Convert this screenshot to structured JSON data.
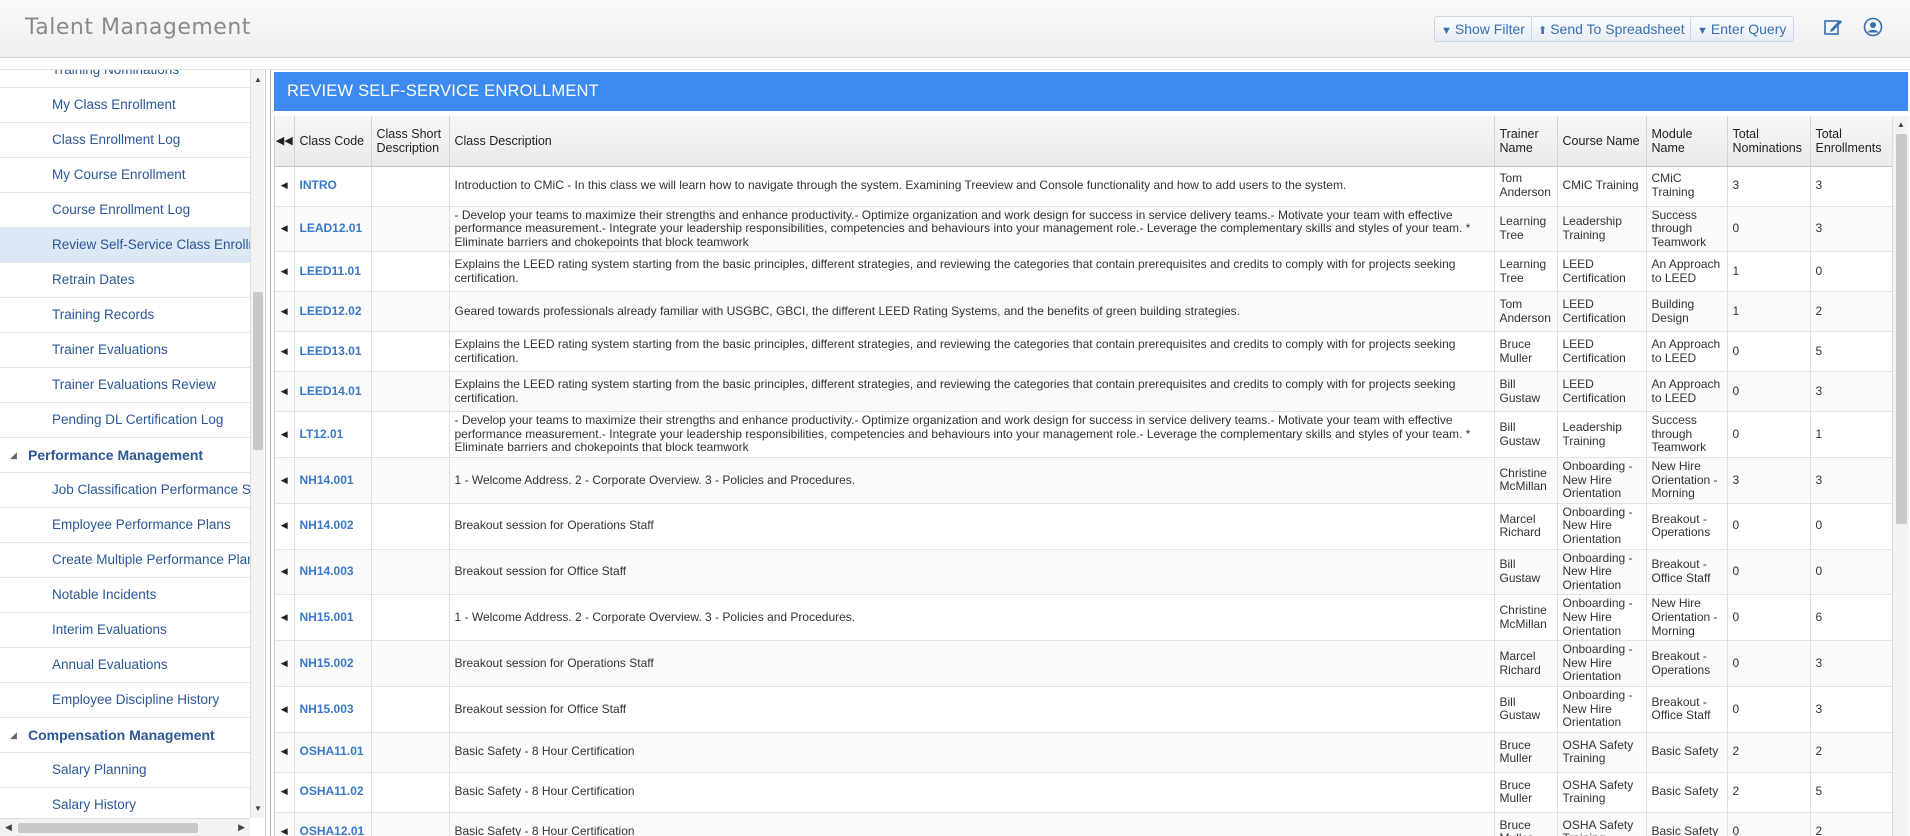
{
  "app": {
    "title": "Talent Management"
  },
  "toolbar": {
    "show_filter": "Show Filter",
    "send_to_spreadsheet": "Send To Spreadsheet",
    "enter_query": "Enter Query"
  },
  "icons": {
    "filter": "funnel-icon",
    "export": "upload-icon",
    "edit": "edit-icon",
    "user": "user-icon"
  },
  "sidebar": {
    "items": [
      "Training Nominations",
      "My Class Enrollment",
      "Class Enrollment Log",
      "My Course Enrollment",
      "Course Enrollment Log",
      "Review Self-Service Class Enrollm",
      "Retrain Dates",
      "Training Records",
      "Trainer Evaluations",
      "Trainer Evaluations Review",
      "Pending DL Certification Log"
    ],
    "selected_index": 5,
    "group_performance": "Performance Management",
    "performance_items": [
      "Job Classification Performance St",
      "Employee Performance Plans",
      "Create Multiple Performance Plans",
      "Notable Incidents",
      "Interim Evaluations",
      "Annual Evaluations",
      "Employee Discipline History"
    ],
    "group_compensation": "Compensation Management",
    "compensation_items": [
      "Salary Planning",
      "Salary History"
    ]
  },
  "page": {
    "banner": "REVIEW SELF-SERVICE ENROLLMENT"
  },
  "grid": {
    "columns": [
      "Class Code",
      "Class Short Description",
      "Class Description",
      "Trainer Name",
      "Course Name",
      "Module Name",
      "Total Nominations",
      "Total Enrollments"
    ],
    "rows": [
      [
        "INTRO",
        "",
        "Introduction to CMiC - In this class we will learn how to navigate through the system. Examining Treeview and Console functionality and how to add users to the system.",
        "Tom Anderson",
        "CMiC Training",
        "CMiC Training",
        "3",
        "3"
      ],
      [
        "LEAD12.01",
        "",
        "- Develop your teams to maximize their strengths and enhance productivity.- Optimize organization and work design for success in service delivery teams.- Motivate your team with effective performance measurement.- Integrate your leadership responsibilities, competencies and behaviours into your management role.- Leverage the complementary skills and styles of your team. * Eliminate barriers and chokepoints that block teamwork",
        "Learning Tree",
        "Leadership Training",
        "Success through Teamwork",
        "0",
        "3"
      ],
      [
        "LEED11.01",
        "",
        "Explains the LEED rating system starting from the basic principles, different strategies, and reviewing the categories that contain prerequisites and credits to comply with for projects seeking certification.",
        "Learning Tree",
        "LEED Certification",
        "An Approach to LEED",
        "1",
        "0"
      ],
      [
        "LEED12.02",
        "",
        "Geared towards professionals already familiar with USGBC, GBCI, the different LEED Rating Systems, and the benefits of green building strategies.",
        "Tom Anderson",
        "LEED Certification",
        "Building Design",
        "1",
        "2"
      ],
      [
        "LEED13.01",
        "",
        "Explains the LEED rating system starting from the basic principles, different strategies, and reviewing the categories that contain prerequisites and credits to comply with for projects seeking certification.",
        "Bruce Muller",
        "LEED Certification",
        "An Approach to LEED",
        "0",
        "5"
      ],
      [
        "LEED14.01",
        "",
        "Explains the LEED rating system starting from the basic principles, different strategies, and reviewing the categories that contain prerequisites and credits to comply with for projects seeking certification.",
        "Bill Gustaw",
        "LEED Certification",
        "An Approach to LEED",
        "0",
        "3"
      ],
      [
        "LT12.01",
        "",
        "- Develop your teams to maximize their strengths and enhance productivity.- Optimize organization and work design for success in service delivery teams.- Motivate your team with effective performance measurement.- Integrate your leadership responsibilities, competencies and behaviours into your management role.- Leverage the complementary skills and styles of your team. * Eliminate barriers and chokepoints that block teamwork",
        "Bill Gustaw",
        "Leadership Training",
        "Success through Teamwork",
        "0",
        "1"
      ],
      [
        "NH14.001",
        "",
        "1 - Welcome Address. 2 - Corporate Overview. 3 - Policies and Procedures.",
        "Christine McMillan",
        "Onboarding - New Hire Orientation",
        "New Hire Orientation - Morning",
        "3",
        "3"
      ],
      [
        "NH14.002",
        "",
        "Breakout session for Operations Staff",
        "Marcel Richard",
        "Onboarding - New Hire Orientation",
        "Breakout - Operations",
        "0",
        "0"
      ],
      [
        "NH14.003",
        "",
        "Breakout session for Office Staff",
        "Bill Gustaw",
        "Onboarding - New Hire Orientation",
        "Breakout - Office Staff",
        "0",
        "0"
      ],
      [
        "NH15.001",
        "",
        "1 - Welcome Address. 2 - Corporate Overview. 3 - Policies and Procedures.",
        "Christine McMillan",
        "Onboarding - New Hire Orientation",
        "New Hire Orientation - Morning",
        "0",
        "6"
      ],
      [
        "NH15.002",
        "",
        "Breakout session for Operations Staff",
        "Marcel Richard",
        "Onboarding - New Hire Orientation",
        "Breakout - Operations",
        "0",
        "3"
      ],
      [
        "NH15.003",
        "",
        "Breakout session for Office Staff",
        "Bill Gustaw",
        "Onboarding - New Hire Orientation",
        "Breakout - Office Staff",
        "0",
        "3"
      ],
      [
        "OSHA11.01",
        "",
        "Basic Safety - 8 Hour Certification",
        "Bruce Muller",
        "OSHA Safety Training",
        "Basic Safety",
        "2",
        "2"
      ],
      [
        "OSHA11.02",
        "",
        "Basic Safety - 8 Hour Certification",
        "Bruce Muller",
        "OSHA Safety Training",
        "Basic Safety",
        "2",
        "5"
      ],
      [
        "OSHA12.01",
        "",
        "Basic Safety - 8 Hour Certification",
        "Bruce Muller",
        "OSHA Safety Training",
        "Basic Safety",
        "0",
        "2"
      ]
    ]
  },
  "colors": {
    "banner": "#3d8bf0",
    "link": "#2b5797",
    "code": "#3a78c9"
  }
}
